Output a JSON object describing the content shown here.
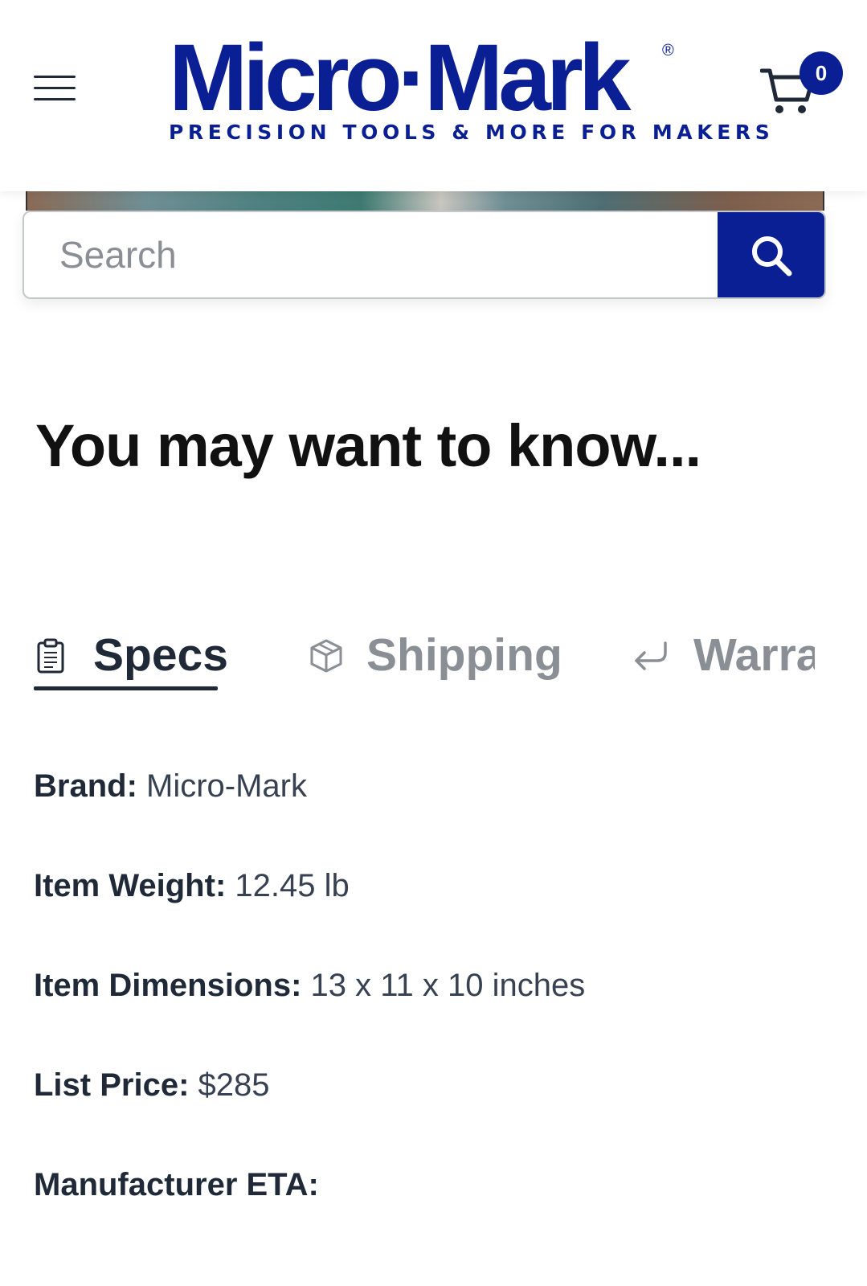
{
  "header": {
    "menu_icon": "hamburger-menu-icon",
    "logo": {
      "wordmark": "Micro·Mark",
      "registered_mark": "®",
      "tagline": "PRECISION TOOLS & MORE FOR MAKERS",
      "color": "#0a1f93"
    },
    "cart": {
      "icon": "shopping-cart-icon",
      "count": "0"
    }
  },
  "search": {
    "placeholder": "Search",
    "value": "",
    "button_icon": "search-icon"
  },
  "section": {
    "title": "You may want to know..."
  },
  "tabs": [
    {
      "label": "Specs",
      "icon": "clipboard-icon",
      "active": true
    },
    {
      "label": "Shipping",
      "icon": "box-icon",
      "active": false
    },
    {
      "label": "Warranty",
      "icon": "return-arrow-icon",
      "active": false
    }
  ],
  "specs": [
    {
      "key": "Brand:",
      "value": "Micro-Mark"
    },
    {
      "key": "Item Weight:",
      "value": "12.45 lb"
    },
    {
      "key": "Item Dimensions:",
      "value": "13 x 11 x 10 inches"
    },
    {
      "key": "List Price:",
      "value": "$285"
    },
    {
      "key": "Manufacturer ETA:",
      "value": ""
    }
  ],
  "colors": {
    "brand_blue": "#0a1f93",
    "text_dark": "#1f2937",
    "text_muted": "#8a8f96"
  }
}
